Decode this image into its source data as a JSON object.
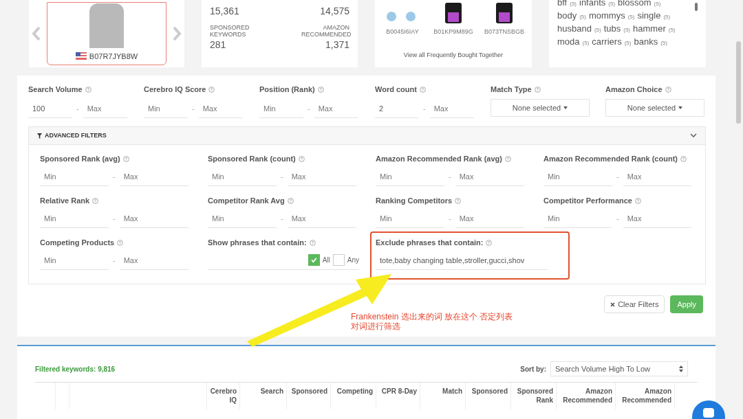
{
  "product_card": {
    "asin": "B07R7JYB8W"
  },
  "stats": [
    {
      "value": "15,361"
    },
    {
      "value": "14,575"
    },
    {
      "label": "SPONSORED KEYWORDS",
      "value": "281"
    },
    {
      "label": "AMAZON RECOMMENDED",
      "value": "1,371"
    }
  ],
  "bought_together": {
    "items": [
      {
        "asin": "B0045I6IAY",
        "kind": "toy"
      },
      {
        "asin": "B01KP9M89G",
        "kind": "phone"
      },
      {
        "asin": "B073TNSBGB",
        "kind": "phone"
      }
    ],
    "link": "View all Frequently Bought Together"
  },
  "word_cloud": [
    [
      {
        "word": "bff",
        "count": "(5)"
      },
      {
        "word": "infants",
        "count": "(5)"
      },
      {
        "word": "blossom",
        "count": "(5)"
      }
    ],
    [
      {
        "word": "body",
        "count": "(5)"
      },
      {
        "word": "mommys",
        "count": "(5)"
      },
      {
        "word": "single",
        "count": "(5)"
      }
    ],
    [
      {
        "word": "husband",
        "count": "(5)"
      },
      {
        "word": "tubs",
        "count": "(5)"
      },
      {
        "word": "hammer",
        "count": "(5)"
      }
    ],
    [
      {
        "word": "moda",
        "count": "(5)"
      },
      {
        "word": "carriers",
        "count": "(5)"
      },
      {
        "word": "banks",
        "count": "(5)"
      }
    ]
  ],
  "filters": [
    {
      "kind": "range",
      "label": "Search Volume",
      "min": {
        "value": "100"
      },
      "separator": "-",
      "max": {
        "placeholder": "Max"
      }
    },
    {
      "kind": "range",
      "label": "Cerebro IQ Score",
      "min": {
        "placeholder": "Min"
      },
      "separator": "-",
      "max": {
        "placeholder": "Max"
      }
    },
    {
      "kind": "range",
      "label": "Position (Rank)",
      "min": {
        "placeholder": "Min"
      },
      "separator": "-",
      "max": {
        "placeholder": "Max"
      }
    },
    {
      "kind": "range",
      "label": "Word count",
      "min": {
        "value": "2"
      },
      "separator": "-",
      "max": {
        "placeholder": "Max"
      }
    },
    {
      "kind": "select",
      "label": "Match Type",
      "value": "None selected"
    },
    {
      "kind": "select",
      "label": "Amazon Choice",
      "value": "None selected"
    }
  ],
  "advanced_filters": {
    "title": "ADVANCED FILTERS",
    "expanded": true,
    "items": [
      {
        "kind": "range",
        "label": "Sponsored Rank (avg)",
        "min": {
          "placeholder": "Min"
        },
        "separator": "-",
        "max": {
          "placeholder": "Max"
        }
      },
      {
        "kind": "range",
        "label": "Sponsored Rank (count)",
        "min": {
          "placeholder": "Min"
        },
        "separator": "-",
        "max": {
          "placeholder": "Max"
        }
      },
      {
        "kind": "range",
        "label": "Amazon Recommended Rank (avg)",
        "min": {
          "placeholder": "Min"
        },
        "separator": "-",
        "max": {
          "placeholder": "Max"
        }
      },
      {
        "kind": "range",
        "label": "Amazon Recommended Rank (count)",
        "min": {
          "placeholder": "Min"
        },
        "separator": "-",
        "max": {
          "placeholder": "Max"
        }
      },
      {
        "kind": "range",
        "label": "Relative Rank",
        "min": {
          "placeholder": "Min"
        },
        "separator": "-",
        "max": {
          "placeholder": "Max"
        }
      },
      {
        "kind": "range",
        "label": "Competitor Rank Avg",
        "min": {
          "placeholder": "Min"
        },
        "separator": "-",
        "max": {
          "placeholder": "Max"
        }
      },
      {
        "kind": "range",
        "label": "Ranking Competitors",
        "min": {
          "placeholder": "Min"
        },
        "separator": "-",
        "max": {
          "placeholder": "Max"
        }
      },
      {
        "kind": "range",
        "label": "Competitor Performance",
        "min": {
          "placeholder": "Min"
        },
        "separator": "-",
        "max": {
          "placeholder": "Max"
        }
      },
      {
        "kind": "range",
        "label": "Competing Products",
        "min": {
          "placeholder": "Min"
        },
        "separator": "-",
        "max": {
          "placeholder": "Max"
        }
      },
      {
        "kind": "match",
        "label": "Show phrases that contain:",
        "options": [
          {
            "label": "All",
            "checked": true
          },
          {
            "label": "Any",
            "checked": false
          }
        ]
      },
      {
        "kind": "text",
        "label": "Exclude phrases that contain:",
        "value": "tote,baby changing table,stroller,gucci,shov",
        "highlighted": true
      }
    ]
  },
  "buttons": [
    {
      "kind": "clear",
      "label": "Clear Filters"
    },
    {
      "kind": "apply",
      "label": "Apply"
    }
  ],
  "annotation": {
    "lines": [
      "Frankenstein 选出来的词 放在这个 否定列表",
      "对词进行筛选"
    ]
  },
  "results": {
    "count_label": "Filtered keywords: 9,816",
    "sort_label": "Sort by:",
    "sort_value": "Search Volume High To Low",
    "columns": [
      "",
      "",
      "",
      "Cerebro IQ",
      "Search",
      "Sponsored",
      "Competing",
      "CPR 8-Day",
      "Match",
      "Sponsored",
      "Sponsored Rank",
      "Amazon Recommended",
      "Amazon Recommended"
    ]
  }
}
